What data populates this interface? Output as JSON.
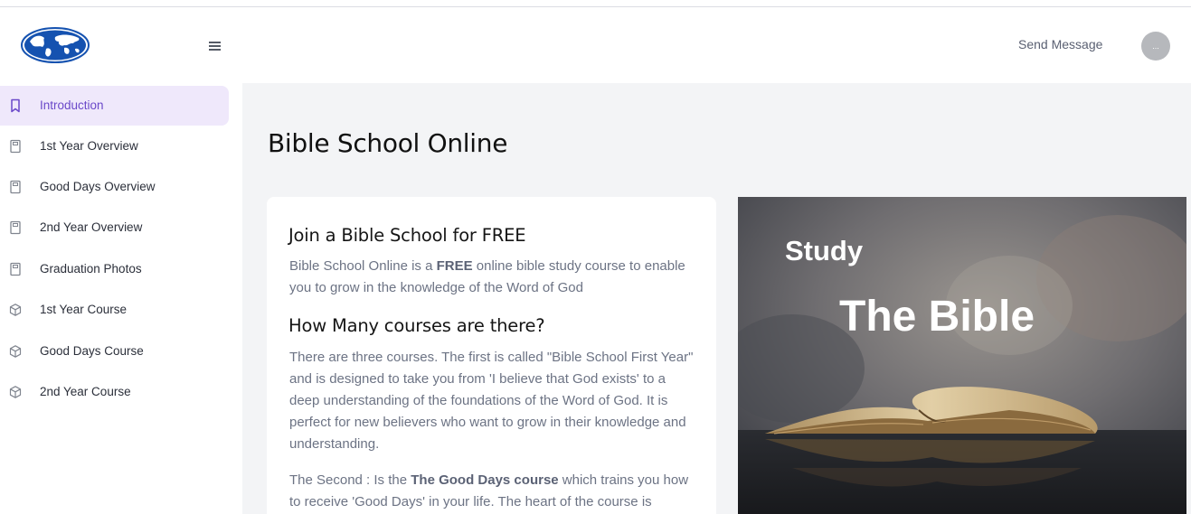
{
  "header": {
    "menu_icon": "hamburger-icon",
    "send_message": "Send Message",
    "avatar_text": "..."
  },
  "sidebar": {
    "items": [
      {
        "label": "Introduction",
        "icon": "bookmark-icon",
        "active": true
      },
      {
        "label": "1st Year Overview",
        "icon": "book-icon"
      },
      {
        "label": "Good Days Overview",
        "icon": "book-icon"
      },
      {
        "label": "2nd Year Overview",
        "icon": "book-icon"
      },
      {
        "label": "Graduation Photos",
        "icon": "book-icon"
      },
      {
        "label": "1st Year Course",
        "icon": "cube-icon"
      },
      {
        "label": "Good Days Course",
        "icon": "cube-icon"
      },
      {
        "label": "2nd Year Course",
        "icon": "cube-icon"
      }
    ]
  },
  "main": {
    "title": "Bible School Online",
    "card": {
      "heading1": "Join a Bible School for FREE",
      "p1_a": "Bible School Online is a ",
      "p1_bold": "FREE",
      "p1_b": " online bible study course to enable you to grow in the knowledge of the Word of God",
      "heading2": "How Many courses are there?",
      "p2": "There are three courses. The first is called \"Bible School First Year\" and is designed to take you from 'I believe that God exists' to a deep understanding of the foundations of the Word of God. It is perfect for new believers who want to grow in their knowledge and understanding.",
      "p3_a": "The Second : Is the ",
      "p3_bold": "The Good Days course",
      "p3_b": " which trains you how to receive 'Good Days' in your life. The heart of the course is"
    },
    "hero": {
      "line1": "Study",
      "line2": "The Bible"
    }
  },
  "colors": {
    "accent": "#6a48c9",
    "active_bg": "#efe8fb",
    "main_bg": "#f3f4f6",
    "logo_blue": "#1552b0"
  }
}
